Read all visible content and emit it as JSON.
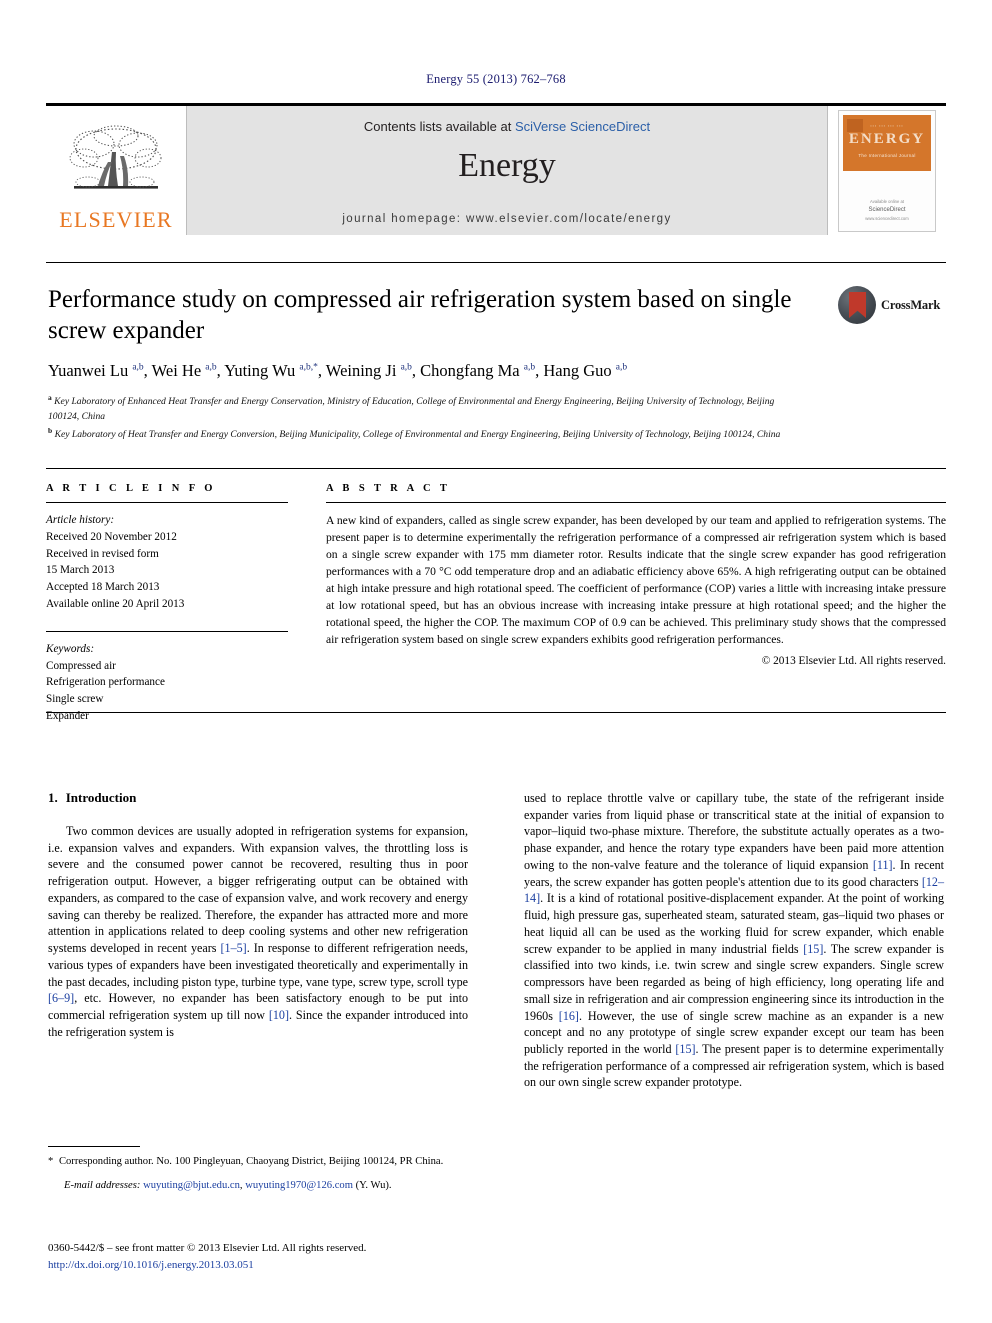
{
  "running_head": "Energy 55 (2013) 762–768",
  "masthead": {
    "contents_prefix": "Contents lists available at ",
    "sciencedirect": "SciVerse ScienceDirect",
    "journal_name": "Energy",
    "homepage": "journal homepage: www.elsevier.com/locate/energy",
    "publisher_logo_text": "ELSEVIER",
    "cover": {
      "title": "ENERGY",
      "subtitle": "The International Journal",
      "footer_line1": "Available online at",
      "footer_line2": "ScienceDirect",
      "footer_line3": "www.sciencedirect.com"
    }
  },
  "crossmark": {
    "label": "CrossMark"
  },
  "article": {
    "title": "Performance study on compressed air refrigeration system based on single screw expander",
    "authors_html": "Yuanwei Lu <sup>a,b</sup>, Wei He <sup>a,b</sup>, Yuting Wu <sup>a,b,*</sup>, Weining Ji <sup>a,b</sup>, Chongfang Ma <sup>a,b</sup>, Hang Guo <sup>a,b</sup>",
    "affiliation_a": "Key Laboratory of Enhanced Heat Transfer and Energy Conservation, Ministry of Education, College of Environmental and Energy Engineering, Beijing University of Technology, Beijing 100124, China",
    "affiliation_b": "Key Laboratory of Heat Transfer and Energy Conversion, Beijing Municipality, College of Environmental and Energy Engineering, Beijing University of Technology, Beijing 100124, China"
  },
  "info": {
    "heading": "A R T I C L E  I N F O",
    "history_label": "Article history:",
    "history": [
      "Received 20 November 2012",
      "Received in revised form",
      "15 March 2013",
      "Accepted 18 March 2013",
      "Available online 20 April 2013"
    ],
    "keywords_label": "Keywords:",
    "keywords": [
      "Compressed air",
      "Refrigeration performance",
      "Single screw",
      "Expander"
    ]
  },
  "abstract": {
    "heading": "A B S T R A C T",
    "text": "A new kind of expanders, called as single screw expander, has been developed by our team and applied to refrigeration systems. The present paper is to determine experimentally the refrigeration performance of a compressed air refrigeration system which is based on a single screw expander with 175 mm diameter rotor. Results indicate that the single screw expander has good refrigeration performances with a 70 °C odd temperature drop and an adiabatic efficiency above 65%. A high refrigerating output can be obtained at high intake pressure and high rotational speed. The coefficient of performance (COP) varies a little with increasing intake pressure at low rotational speed, but has an obvious increase with increasing intake pressure at high rotational speed; and the higher the rotational speed, the higher the COP. The maximum COP of 0.9 can be achieved. This preliminary study shows that the compressed air refrigeration system based on single screw expanders exhibits good refrigeration performances.",
    "copyright": "© 2013 Elsevier Ltd. All rights reserved."
  },
  "introduction": {
    "number": "1.",
    "heading": "Introduction",
    "left_paragraph_part1": "Two common devices are usually adopted in refrigeration systems for expansion, i.e. expansion valves and expanders. With expansion valves, the throttling loss is severe and the consumed power cannot be recovered, resulting thus in poor refrigeration output. However, a bigger refrigerating output can be obtained with expanders, as compared to the case of expansion valve, and work recovery and energy saving can thereby be realized. Therefore, the expander has attracted more and more attention in applications related to deep cooling systems and other new refrigeration systems developed in recent years ",
    "ref_1_5": "[1–5]",
    "left_paragraph_part2": ". In response to different refrigeration needs, various types of expanders have been investigated theoretically and experimentally in the past decades, including piston type, turbine type, vane type, screw type, scroll type ",
    "ref_6_9": "[6–9]",
    "left_paragraph_part3": ", etc. However, no expander has been satisfactory enough to be put into commercial refrigeration system up till now ",
    "ref_10": "[10]",
    "left_paragraph_part4": ". Since the expander introduced into the refrigeration system is",
    "right_paragraph_part1": "used to replace throttle valve or capillary tube, the state of the refrigerant inside expander varies from liquid phase or transcritical state at the initial of expansion to vapor–liquid two-phase mixture. Therefore, the substitute actually operates as a two-phase expander, and hence the rotary type expanders have been paid more attention owing to the non-valve feature and the tolerance of liquid expansion ",
    "ref_11": "[11]",
    "right_paragraph_part2": ". In recent years, the screw expander has gotten people's attention due to its good characters ",
    "ref_12_14": "[12–14]",
    "right_paragraph_part3": ". It is a kind of rotational positive-displacement expander. At the point of working fluid, high pressure gas, superheated steam, saturated steam, gas–liquid two phases or heat liquid all can be used as the working fluid for screw expander, which enable screw expander to be applied in many industrial fields ",
    "ref_15a": "[15]",
    "right_paragraph_part4": ". The screw expander is classified into two kinds, i.e. twin screw and single screw expanders. Single screw compressors have been regarded as being of high efficiency, long operating life and small size in refrigeration and air compression engineering since its introduction in the 1960s ",
    "ref_16": "[16]",
    "right_paragraph_part5": ". However, the use of single screw machine as an expander is a new concept and no any prototype of single screw expander except our team has been publicly reported in the world ",
    "ref_15b": "[15]",
    "right_paragraph_part6": ". The present paper is to determine experimentally the refrigeration performance of a compressed air refrigeration system, which is based on our own single screw expander prototype."
  },
  "footnote": {
    "star": "*",
    "corresponding": " Corresponding author. No. 100 Pingleyuan, Chaoyang District, Beijing 100124, PR China.",
    "email_label": "E-mail addresses:",
    "email_1": "wuyuting@bjut.edu.cn",
    "email_sep": ", ",
    "email_2": "wuyuting1970@126.com",
    "email_suffix": " (Y. Wu)."
  },
  "colophon": {
    "issn_line": "0360-5442/$ – see front matter © 2013 Elsevier Ltd. All rights reserved.",
    "doi": "http://dx.doi.org/10.1016/j.energy.2013.03.051"
  }
}
